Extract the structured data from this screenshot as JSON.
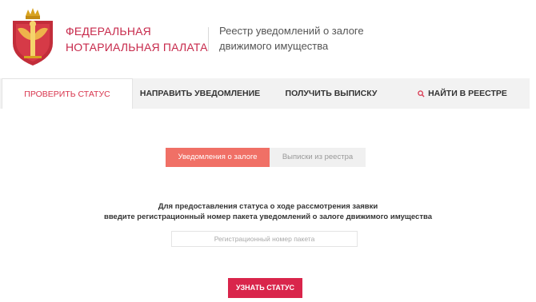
{
  "header": {
    "org_line1": "ФЕДЕРАЛЬНАЯ",
    "org_line2": "НОТАРИАЛЬНАЯ ПАЛАТА",
    "registry_line1": "Реестр уведомлений о залоге",
    "registry_line2": "движимого имущества"
  },
  "nav": {
    "tabs": [
      {
        "label": "ПРОВЕРИТЬ СТАТУС",
        "active": true
      },
      {
        "label": "НАПРАВИТЬ УВЕДОМЛЕНИЕ",
        "active": false
      },
      {
        "label": "ПОЛУЧИТЬ ВЫПИСКУ",
        "active": false
      },
      {
        "label": "НАЙТИ В РЕЕСТРЕ",
        "active": false,
        "icon": "search-icon"
      }
    ]
  },
  "toggle": {
    "selected": "Уведомления о залоге",
    "other": "Выписки из реестра"
  },
  "form": {
    "instruction_line1": "Для предоставления статуса о ходе рассмотрения заявки",
    "instruction_line2": "введите регистрационный номер пакета уведомлений о залоге движимого имущества",
    "input_placeholder": "Регистрационный номер пакета",
    "input_value": "",
    "submit_label": "УЗНАТЬ СТАТУС"
  },
  "colors": {
    "brand": "#c7294b",
    "accent_button": "#d9254b",
    "toggle_active": "#f07066",
    "nav_bg": "#f2f2f2"
  }
}
